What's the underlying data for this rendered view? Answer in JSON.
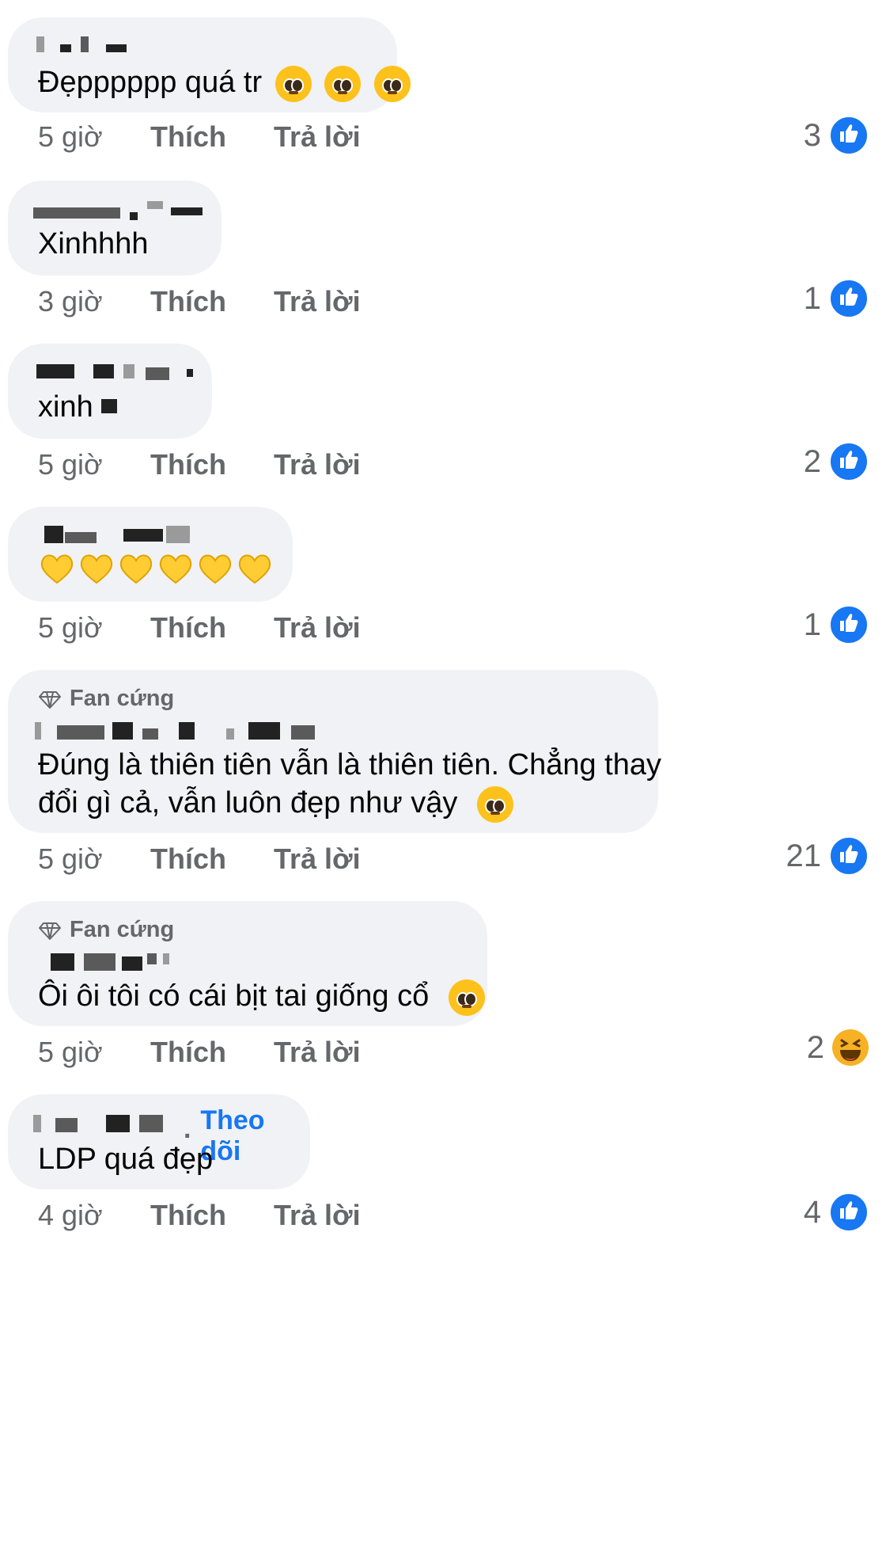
{
  "comments": [
    {
      "text": "Đẹpppppp quá tr",
      "time": "5 giờ",
      "like_label": "Thích",
      "reply_label": "Trả lời",
      "reaction_count": "3",
      "reaction_type": "like-icon",
      "emoji": [
        "pleading-face-icon",
        "pleading-face-icon",
        "pleading-face-icon"
      ]
    },
    {
      "text": "Xinhhhh",
      "time": "3 giờ",
      "like_label": "Thích",
      "reply_label": "Trả lời",
      "reaction_count": "1",
      "reaction_type": "like-icon"
    },
    {
      "text": "xinh",
      "time": "5 giờ",
      "like_label": "Thích",
      "reply_label": "Trả lời",
      "reaction_count": "2",
      "reaction_type": "like-icon"
    },
    {
      "text": "",
      "time": "5 giờ",
      "like_label": "Thích",
      "reply_label": "Trả lời",
      "reaction_count": "1",
      "reaction_type": "like-icon",
      "emoji": [
        "yellow-heart-icon",
        "yellow-heart-icon",
        "yellow-heart-icon",
        "yellow-heart-icon",
        "yellow-heart-icon",
        "yellow-heart-icon"
      ]
    },
    {
      "badge": "Fan cứng",
      "text_line1": "Đúng là thiên tiên vẫn là thiên tiên. Chẳng thay",
      "text_line2": "đổi gì cả, vẫn luôn đẹp như vậy",
      "time": "5 giờ",
      "like_label": "Thích",
      "reply_label": "Trả lời",
      "reaction_count": "21",
      "reaction_type": "like-icon"
    },
    {
      "badge": "Fan cứng",
      "text": "Ôi ôi tôi có cái bịt tai giống cổ",
      "time": "5 giờ",
      "like_label": "Thích",
      "reply_label": "Trả lời",
      "reaction_count": "2",
      "reaction_type": "haha-icon"
    },
    {
      "follow": "Theo dõi",
      "separator": "·",
      "text": "LDP quá đẹp",
      "time": "4 giờ",
      "like_label": "Thích",
      "reply_label": "Trả lời",
      "reaction_count": "4",
      "reaction_type": "like-icon"
    }
  ],
  "colors": {
    "bubble": "#f0f2f5",
    "muted": "#65676b",
    "link": "#1877f2",
    "like": "#1877f2",
    "haha": "#f7b125"
  }
}
